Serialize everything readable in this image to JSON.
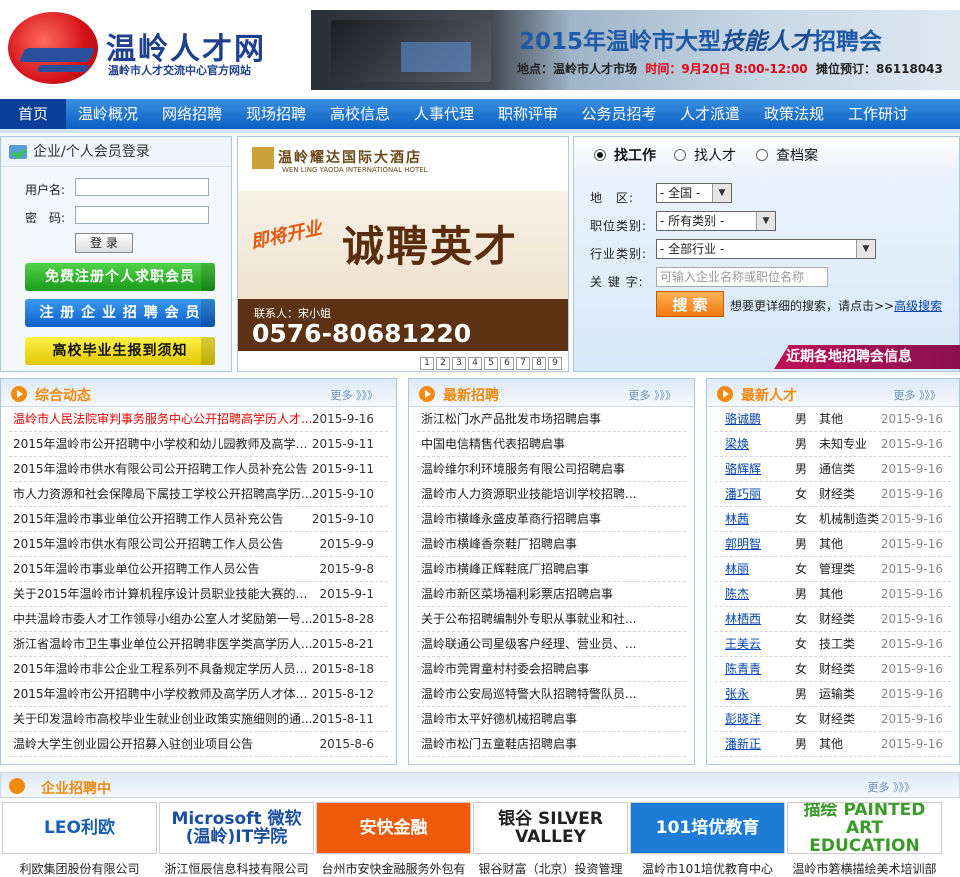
{
  "header": {
    "site_name": "温岭人才网",
    "site_subtitle": "温岭市人才交流中心官方网站",
    "banner_title": "2015年温岭市大型",
    "banner_title_em": "技能人才",
    "banner_title_tail": "招聘会",
    "banner_place_label": "地点：",
    "banner_place": "温岭市人才市场",
    "banner_time_label": "时间：",
    "banner_time": "9月20日 8:00-12:00",
    "banner_booth_label": "摊位预订：",
    "banner_booth": "86118043"
  },
  "nav": {
    "items": [
      "首页",
      "温岭概况",
      "网络招聘",
      "现场招聘",
      "高校信息",
      "人事代理",
      "职称评审",
      "公务员招考",
      "人才派遣",
      "政策法规",
      "工作研讨"
    ]
  },
  "login": {
    "title": "企业/个人会员登录",
    "username_label": "用户名:",
    "password_label": "密　码:",
    "login_button": "登 录",
    "register_person": "免费注册个人求职会员",
    "register_company": "注 册 企 业 招 聘 会 员",
    "graduate_notice": "高校毕业生报到须知"
  },
  "ad": {
    "hotel": "温岭耀达国际大酒店",
    "hotel_en": "WEN LING YAODA INTERNATIONAL HOTEL",
    "opening": "即将开业",
    "hire": "诚聘英才",
    "contact": "联系人：宋小姐",
    "phone": "0576-80681220",
    "pages": [
      "1",
      "2",
      "3",
      "4",
      "5",
      "6",
      "7",
      "8",
      "9"
    ]
  },
  "search": {
    "tab_job": "找工作",
    "tab_talent": "找人才",
    "tab_archive": "查档案",
    "area_label": "地　区:",
    "area_value": "- 全国 -",
    "category_label": "职位类别:",
    "category_value": "- 所有类别 -",
    "industry_label": "行业类别:",
    "industry_value": "- 全部行业 -",
    "keyword_label": "关 键 字:",
    "keyword_placeholder": "可输入企业名称或职位名称",
    "search_button": "搜 索",
    "advanced_hint": "想要更详细的搜索，请点击>>",
    "advanced_link": "高级搜索",
    "recent_fairs": "近期各地招聘会信息"
  },
  "news": {
    "title": "综合动态",
    "more": "更多 》》》",
    "items": [
      {
        "title": "温岭市人民法院审判事务服务中心公开招聘高学历人才...",
        "date": "2015-9-16",
        "hot": true
      },
      {
        "title": "2015年温岭市公开招聘中小学校和幼儿园教师及高学历...",
        "date": "2015-9-11"
      },
      {
        "title": "2015年温岭市供水有限公司公开招聘工作人员补充公告",
        "date": "2015-9-11"
      },
      {
        "title": "市人力资源和社会保障局下属技工学校公开招聘高学历...",
        "date": "2015-9-10"
      },
      {
        "title": "2015年温岭市事业单位公开招聘工作人员补充公告",
        "date": "2015-9-10"
      },
      {
        "title": "2015年温岭市供水有限公司公开招聘工作人员公告",
        "date": "2015-9-9"
      },
      {
        "title": "2015年温岭市事业单位公开招聘工作人员公告",
        "date": "2015-9-8"
      },
      {
        "title": "关于2015年温岭市计算机程序设计员职业技能大赛的补...",
        "date": "2015-9-1"
      },
      {
        "title": "中共温岭市委人才工作领导小组办公室人才奖励第一号...",
        "date": "2015-8-28"
      },
      {
        "title": "浙江省温岭市卫生事业单位公开招聘非医学类高学历人...",
        "date": "2015-8-21"
      },
      {
        "title": "2015年温岭市非公企业工程系列不具备规定学历人员晋...",
        "date": "2015-8-18"
      },
      {
        "title": "2015年温岭市公开招聘中小学校教师及高学历人才体检...",
        "date": "2015-8-12"
      },
      {
        "title": "关于印发温岭市高校毕业生就业创业政策实施细则的通...",
        "date": "2015-8-11"
      },
      {
        "title": "温岭大学生创业园公开招募入驻创业项目公告",
        "date": "2015-8-6"
      }
    ]
  },
  "jobs": {
    "title": "最新招聘",
    "more": "更多 》》》",
    "items": [
      "浙江松门水产品批发市场招聘启事",
      "中国电信精售代表招聘启事",
      "温岭维尔利环境服务有限公司招聘启事",
      "温岭市人力资源职业技能培训学校招聘...",
      "温岭市横峰永盛皮革商行招聘启事",
      "温岭市横峰香奈鞋厂招聘启事",
      "温岭市横峰正辉鞋底厂招聘启事",
      "温岭市新区菜场福利彩票店招聘启事",
      "关于公布招聘编制外专职从事就业和社...",
      "温岭联通公司星级客户经理、营业员、...",
      "温岭市莞胃童村村委会招聘启事",
      "温岭市公安局巡特警大队招聘特警队员...",
      "温岭市太平好德机械招聘启事",
      "温岭市松门五童鞋店招聘启事"
    ]
  },
  "talents": {
    "title": "最新人才",
    "more": "更多 》》》",
    "items": [
      {
        "name": "骆诚鹏",
        "sex": "男",
        "major": "其他",
        "date": "2015-9-16"
      },
      {
        "name": "梁焕",
        "sex": "男",
        "major": "未知专业",
        "date": "2015-9-16"
      },
      {
        "name": "骆辉辉",
        "sex": "男",
        "major": "通信类",
        "date": "2015-9-16"
      },
      {
        "name": "潘巧丽",
        "sex": "女",
        "major": "财经类",
        "date": "2015-9-16"
      },
      {
        "name": "林茜",
        "sex": "女",
        "major": "机械制造类",
        "date": "2015-9-16"
      },
      {
        "name": "郭明智",
        "sex": "男",
        "major": "其他",
        "date": "2015-9-16"
      },
      {
        "name": "林丽",
        "sex": "女",
        "major": "管理类",
        "date": "2015-9-16"
      },
      {
        "name": "陈杰",
        "sex": "男",
        "major": "其他",
        "date": "2015-9-16"
      },
      {
        "name": "林栖西",
        "sex": "女",
        "major": "财经类",
        "date": "2015-9-16"
      },
      {
        "name": "王美云",
        "sex": "女",
        "major": "技工类",
        "date": "2015-9-16"
      },
      {
        "name": "陈青青",
        "sex": "女",
        "major": "财经类",
        "date": "2015-9-16"
      },
      {
        "name": "张永",
        "sex": "男",
        "major": "运输类",
        "date": "2015-9-16"
      },
      {
        "name": "彭晓洋",
        "sex": "女",
        "major": "财经类",
        "date": "2015-9-16"
      },
      {
        "name": "潘新正",
        "sex": "男",
        "major": "其他",
        "date": "2015-9-16"
      }
    ]
  },
  "enterprise": {
    "title": "企业招聘中",
    "more": "更多 》》》",
    "logos": [
      {
        "text": "LEO利欧",
        "caption": "利欧集团股份有限公司",
        "color": "#1a5fb4"
      },
      {
        "text": "Microsoft 微软(温岭)IT学院",
        "caption": "浙江恒辰信息科技有限公司",
        "color": "#1a4fa0"
      },
      {
        "text": "安快金融",
        "caption": "台州市安快金融服务外包有",
        "color": "#ffffff"
      },
      {
        "text": "银谷 SILVER VALLEY",
        "caption": "银谷财富（北京）投资管理",
        "color": "#222222"
      },
      {
        "text": "101培优教育",
        "caption": "温岭市101培优教育中心",
        "color": "#ffffff"
      },
      {
        "text": "描绘 PAINTED ART EDUCATION",
        "caption": "温岭市箬横描绘美术培训部",
        "color": "#3a9a2a"
      }
    ]
  }
}
